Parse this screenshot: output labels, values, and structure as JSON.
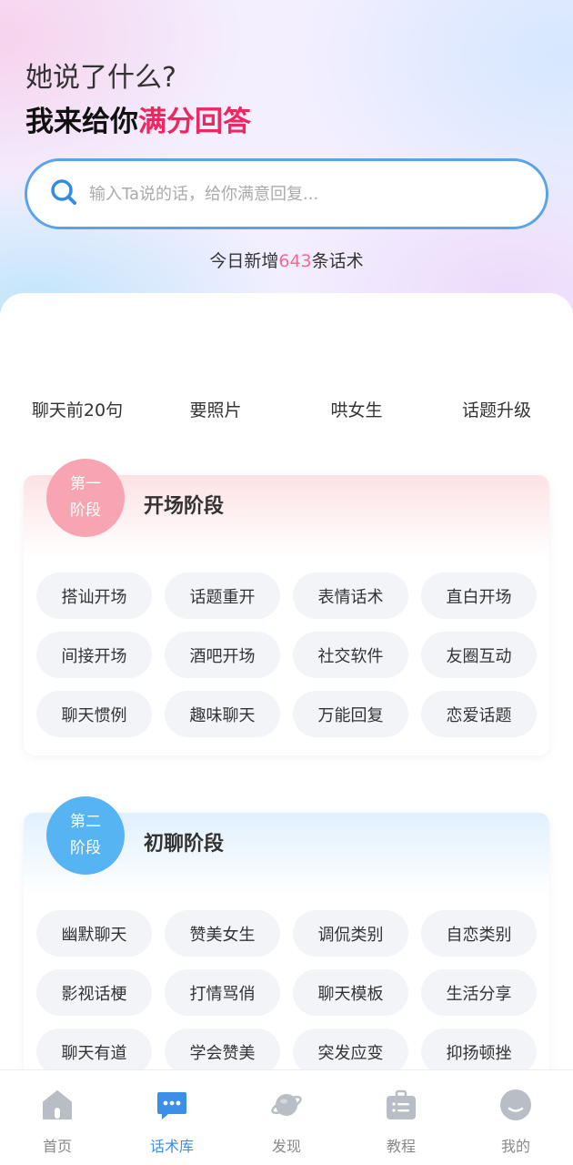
{
  "hero": {
    "line1": "她说了什么?",
    "line2_prefix": "我来给你",
    "line2_highlight": "满分回答"
  },
  "search": {
    "placeholder": "输入Ta说的话，给你满意回复...",
    "icon": "search-icon"
  },
  "stat": {
    "prefix": "今日新增",
    "count": "643",
    "suffix": "条话术"
  },
  "categories": [
    "聊天前20句",
    "要照片",
    "哄女生",
    "话题升级"
  ],
  "stages": [
    {
      "badge_line1": "第一",
      "badge_line2": "阶段",
      "title": "开场阶段",
      "color": "#f8a5b3",
      "tags": [
        "搭讪开场",
        "话题重开",
        "表情话术",
        "直白开场",
        "间接开场",
        "酒吧开场",
        "社交软件",
        "友圈互动",
        "聊天惯例",
        "趣味聊天",
        "万能回复",
        "恋爱话题"
      ]
    },
    {
      "badge_line1": "第二",
      "badge_line2": "阶段",
      "title": "初聊阶段",
      "color": "#57b4f3",
      "tags": [
        "幽默聊天",
        "赞美女生",
        "调侃类别",
        "自恋类别",
        "影视话梗",
        "打情骂俏",
        "聊天模板",
        "生活分享",
        "聊天有道",
        "学会赞美",
        "突发应变",
        "抑扬顿挫"
      ]
    }
  ],
  "tabbar": {
    "active_color": "#3b8fe6",
    "items": [
      {
        "label": "首页",
        "icon": "home-icon"
      },
      {
        "label": "话术库",
        "icon": "chat-bubble-icon",
        "active": true
      },
      {
        "label": "发现",
        "icon": "planet-icon"
      },
      {
        "label": "教程",
        "icon": "briefcase-list-icon"
      },
      {
        "label": "我的",
        "icon": "profile-icon"
      }
    ]
  }
}
